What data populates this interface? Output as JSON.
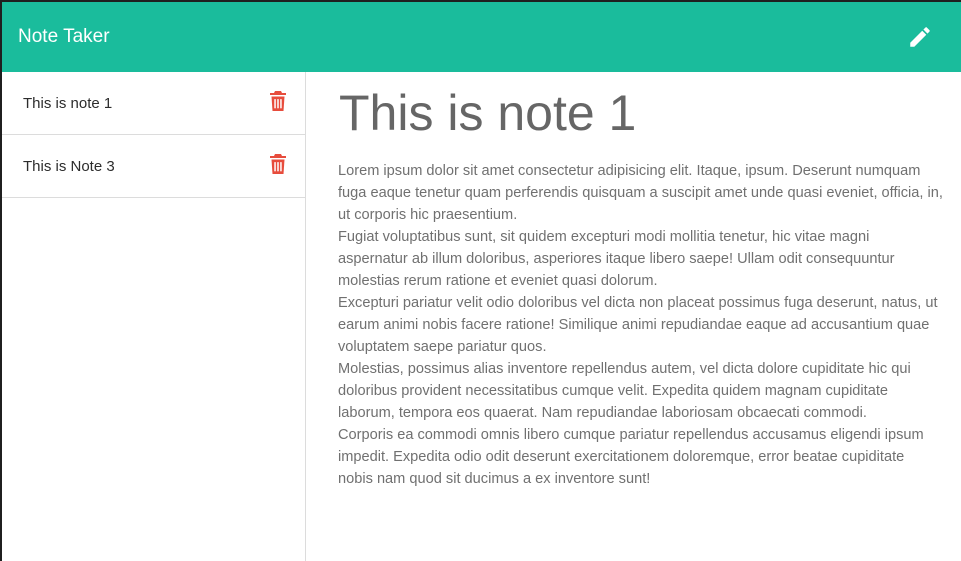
{
  "app": {
    "title": "Note Taker"
  },
  "toolbar": {
    "new_note_icon": "pencil-icon"
  },
  "notes": [
    {
      "title": "This is note 1",
      "delete_icon": "trash-icon"
    },
    {
      "title": "This is Note 3",
      "delete_icon": "trash-icon"
    }
  ],
  "active_note": {
    "title": "This is note 1",
    "paragraphs": [
      "Lorem ipsum dolor sit amet consectetur adipisicing elit. Itaque, ipsum. Deserunt numquam fuga eaque tenetur quam perferendis quisquam a suscipit amet unde quasi eveniet, officia, in, ut corporis hic praesentium.",
      "Fugiat voluptatibus sunt, sit quidem excepturi modi mollitia tenetur, hic vitae magni aspernatur ab illum doloribus, asperiores itaque libero saepe! Ullam odit consequuntur molestias rerum ratione et eveniet quasi dolorum.",
      "Excepturi pariatur velit odio doloribus vel dicta non placeat possimus fuga deserunt, natus, ut earum animi nobis facere ratione! Similique animi repudiandae eaque ad accusantium quae voluptatem saepe pariatur quos.",
      "Molestias, possimus alias inventore repellendus autem, vel dicta dolore cupiditate hic qui doloribus provident necessitatibus cumque velit. Expedita quidem magnam cupiditate laborum, tempora eos quaerat. Nam repudiandae laboriosam obcaecati commodi.",
      "Corporis ea commodi omnis libero cumque pariatur repellendus accusamus eligendi ipsum impedit. Expedita odio odit deserunt exercitationem doloremque, error beatae cupiditate nobis nam quod sit ducimus a ex inventore sunt!"
    ]
  },
  "colors": {
    "navbar": "#1abc9c",
    "delete": "#e74c3c",
    "heading": "#666666",
    "body_text": "#707070"
  }
}
